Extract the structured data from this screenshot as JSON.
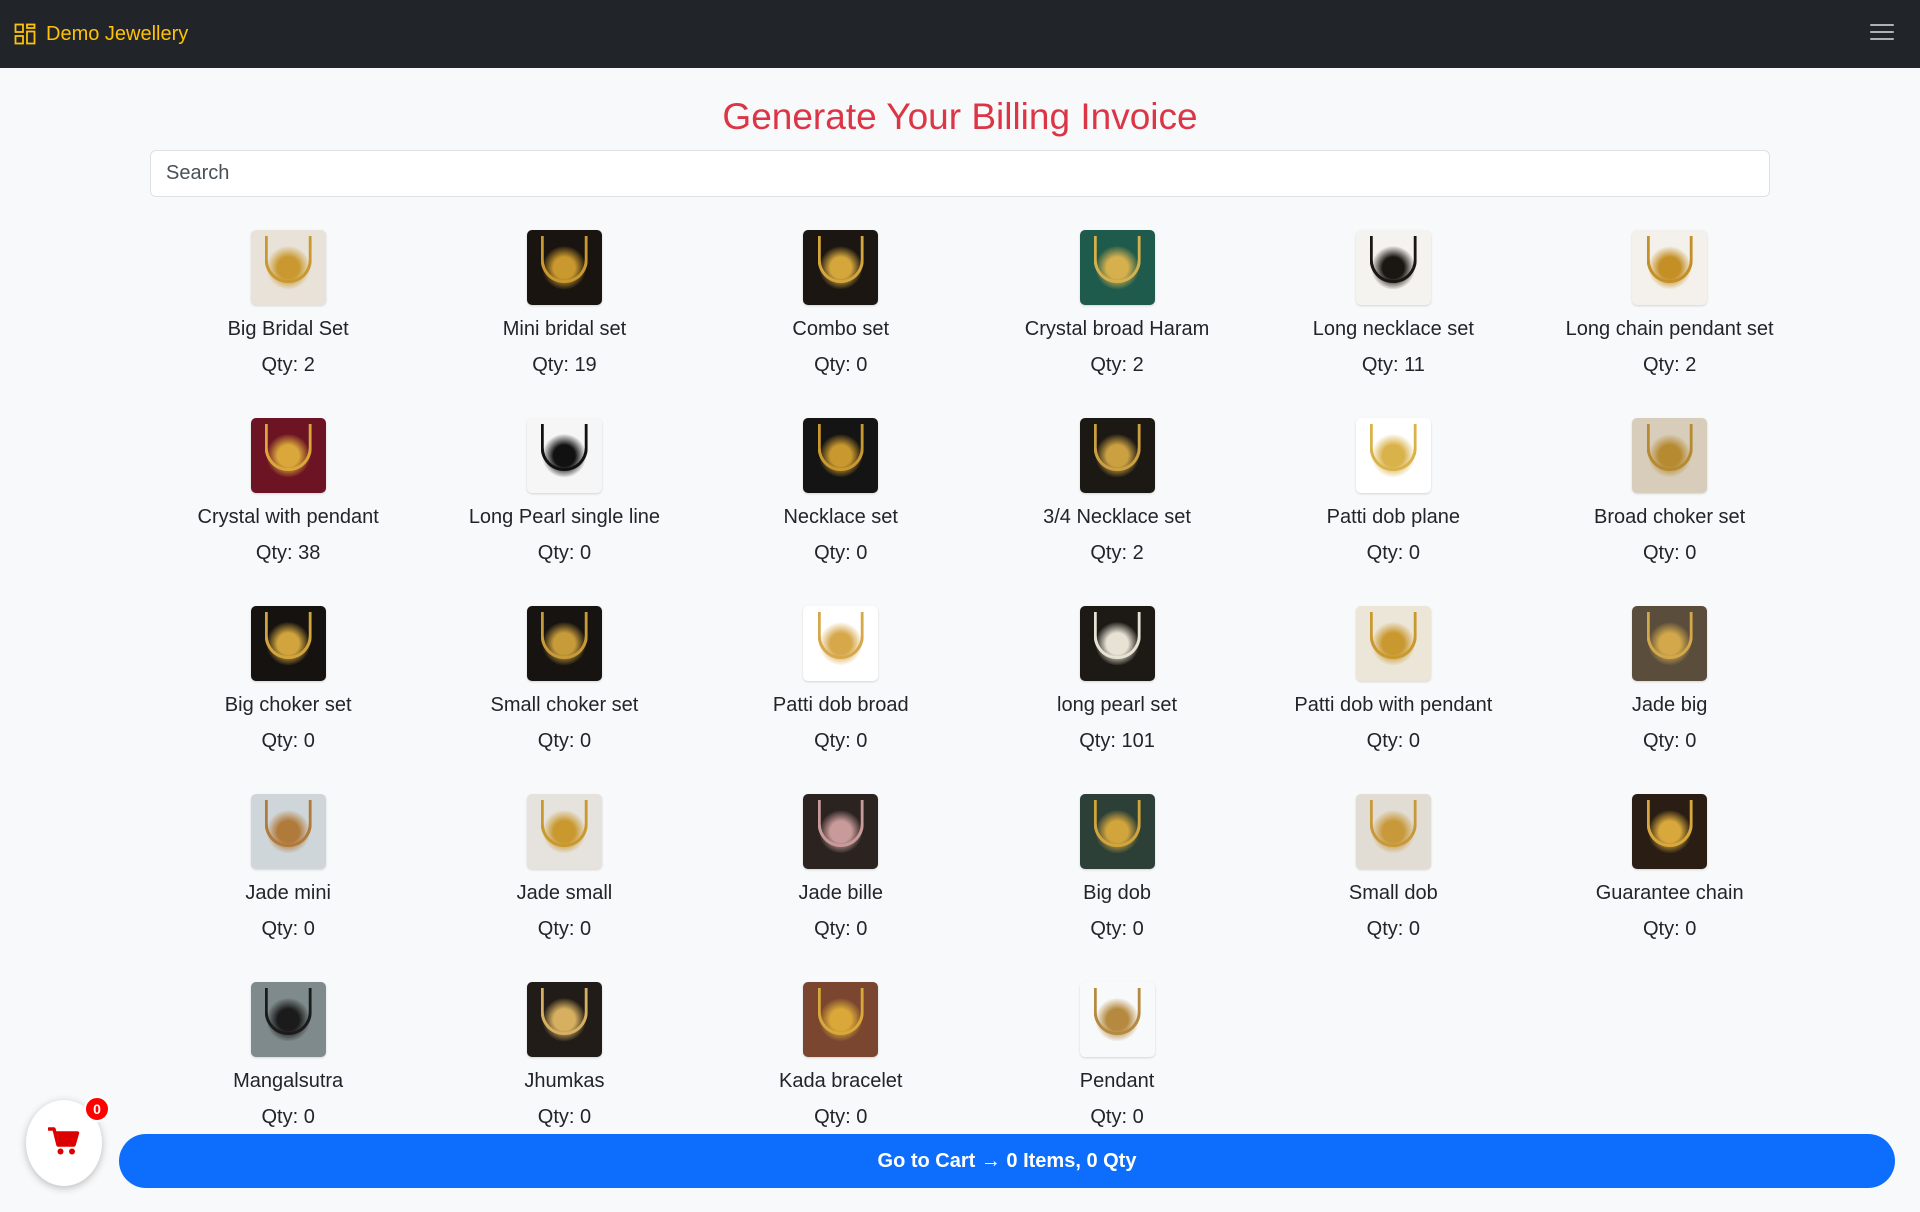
{
  "navbar": {
    "brand": "Demo Jewellery"
  },
  "page": {
    "title": "Generate Your Billing Invoice"
  },
  "search": {
    "placeholder": "Search",
    "value": ""
  },
  "qty_prefix": "Qty: ",
  "products": [
    {
      "name": "Big Bridal Set",
      "qty": 2,
      "bg": "#e8e2d8",
      "tone": "#c9982e"
    },
    {
      "name": "Mini bridal set",
      "qty": 19,
      "bg": "#1a1410",
      "tone": "#c9982e"
    },
    {
      "name": "Combo set",
      "qty": 0,
      "bg": "#1b1612",
      "tone": "#d4a63c"
    },
    {
      "name": "Crystal broad Haram",
      "qty": 2,
      "bg": "#1f5b4c",
      "tone": "#d6b04d"
    },
    {
      "name": "Long necklace set",
      "qty": 11,
      "bg": "#f5f3f0",
      "tone": "#1a1612"
    },
    {
      "name": "Long chain pendant set",
      "qty": 2,
      "bg": "#f4f1ec",
      "tone": "#c48f24"
    },
    {
      "name": "Crystal with pendant",
      "qty": 38,
      "bg": "#6d1424",
      "tone": "#d9a73a"
    },
    {
      "name": "Long Pearl single line",
      "qty": 0,
      "bg": "#f6f6f6",
      "tone": "#111111"
    },
    {
      "name": "Necklace set",
      "qty": 0,
      "bg": "#141414",
      "tone": "#c9982e"
    },
    {
      "name": "3/4 Necklace set",
      "qty": 2,
      "bg": "#1c1814",
      "tone": "#caa041"
    },
    {
      "name": "Patti dob plane",
      "qty": 0,
      "bg": "#ffffff",
      "tone": "#d9b24a"
    },
    {
      "name": "Broad choker set",
      "qty": 0,
      "bg": "#d8cdbb",
      "tone": "#b58a30"
    },
    {
      "name": "Big choker set",
      "qty": 0,
      "bg": "#151210",
      "tone": "#d1a43d"
    },
    {
      "name": "Small choker set",
      "qty": 0,
      "bg": "#161311",
      "tone": "#c79b3a"
    },
    {
      "name": "Patti dob broad",
      "qty": 0,
      "bg": "#ffffff",
      "tone": "#d6a84a"
    },
    {
      "name": "long pearl set",
      "qty": 101,
      "bg": "#1d1a16",
      "tone": "#e8e2d4"
    },
    {
      "name": "Patti dob with pendant",
      "qty": 0,
      "bg": "#ece6d8",
      "tone": "#c9982e"
    },
    {
      "name": "Jade big",
      "qty": 0,
      "bg": "#5a4d3c",
      "tone": "#d2a84a"
    },
    {
      "name": "Jade mini",
      "qty": 0,
      "bg": "#cfd6da",
      "tone": "#b07a3a"
    },
    {
      "name": "Jade small",
      "qty": 0,
      "bg": "#e6e3de",
      "tone": "#c9982e"
    },
    {
      "name": "Jade bille",
      "qty": 0,
      "bg": "#2a2320",
      "tone": "#c89a9a"
    },
    {
      "name": "Big dob",
      "qty": 0,
      "bg": "#2c4038",
      "tone": "#d2a43c"
    },
    {
      "name": "Small dob",
      "qty": 0,
      "bg": "#e2ddd4",
      "tone": "#c8993a"
    },
    {
      "name": "Guarantee chain",
      "qty": 0,
      "bg": "#2a1e14",
      "tone": "#d8a83c"
    },
    {
      "name": "Mangalsutra",
      "qty": 0,
      "bg": "#7f8a8c",
      "tone": "#1b1b1b"
    },
    {
      "name": "Jhumkas",
      "qty": 0,
      "bg": "#221c18",
      "tone": "#d6b060"
    },
    {
      "name": "Kada bracelet",
      "qty": 0,
      "bg": "#7a4630",
      "tone": "#d9a838"
    },
    {
      "name": "Pendant",
      "qty": 0,
      "bg": "#f8f9fa",
      "tone": "#b58a40"
    }
  ],
  "cart": {
    "badge_count": "0",
    "go_to_cart_label": "Go to Cart → 0 Items, 0 Qty"
  },
  "colors": {
    "navbar_bg": "#212529",
    "brand": "#ffc107",
    "title": "#dc3545",
    "primary_button": "#0d6efd",
    "cart_icon": "#dc0000"
  },
  "icons": {
    "brand": "grid-icon",
    "menu": "hamburger-icon",
    "cart": "shopping-cart-icon"
  }
}
